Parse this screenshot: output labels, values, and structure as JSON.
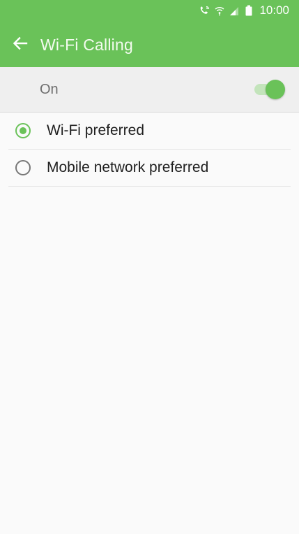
{
  "status_bar": {
    "time": "10:00",
    "icons": [
      "wifi-calling-icon",
      "wifi-signal-icon",
      "cellular-signal-icon",
      "battery-icon"
    ]
  },
  "app_bar": {
    "back_icon": "arrow-left-icon",
    "title": "Wi-Fi Calling"
  },
  "master_switch": {
    "label": "On",
    "state": true
  },
  "options": [
    {
      "label": "Wi-Fi preferred",
      "selected": true
    },
    {
      "label": "Mobile network preferred",
      "selected": false
    }
  ],
  "colors": {
    "accent": "#6ac259",
    "toggle_track": "#c3e4bb",
    "background": "#fafafa",
    "switch_row_bg": "#efefef"
  }
}
